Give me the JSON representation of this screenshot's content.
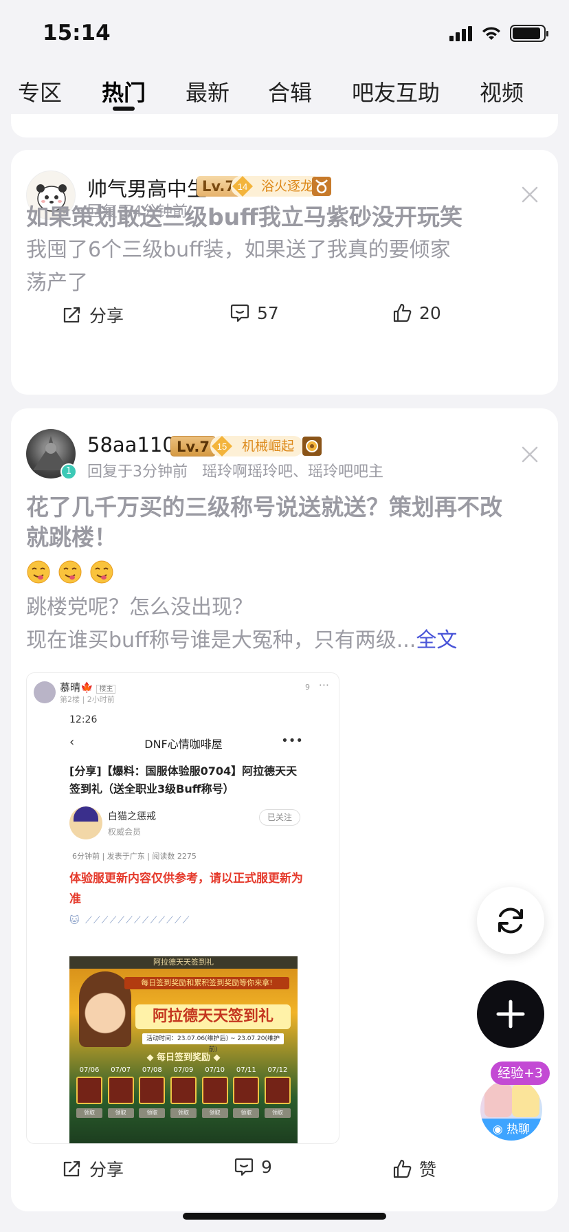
{
  "status_bar": {
    "time": "15:14"
  },
  "tabs": [
    {
      "label": "专区"
    },
    {
      "label": "热门"
    },
    {
      "label": "最新"
    },
    {
      "label": "合辑"
    },
    {
      "label": "吧友互助"
    },
    {
      "label": "视频"
    }
  ],
  "active_tab": "热门",
  "posts": [
    {
      "author": "帅气男高中生",
      "level": "Lv.7",
      "honor_level": "14",
      "honor_title": "浴火逐龙",
      "zodiac_icon": "taurus-icon",
      "meta": "回复于4分钟前",
      "title": "如果策划敢送三级buff我立马紫砂没开玩笑",
      "body": [
        "我囤了6个三级buff装，如果送了我真的要倾家",
        "荡产了"
      ],
      "share_label": "分享",
      "comment_count": "57",
      "like_count": "20"
    },
    {
      "author": "58aa110",
      "level": "Lv.7",
      "honor_level": "15",
      "honor_title": "机械崛起",
      "meta": "回复于3分钟前   瑶玲啊瑶玲吧、瑶玲吧吧主",
      "title": [
        "花了几千万买的三级称号说送就送？策划再不改",
        "就跳楼！"
      ],
      "body": [
        "跳楼党呢？怎么没出现？",
        "现在谁买buff称号谁是大冤种，只有两级..."
      ],
      "more_label": "全文",
      "share_label": "分享",
      "comment_count": "9",
      "like_label": "赞",
      "screenshot": {
        "poster": "慕晴🍁",
        "poster_badge": "楼主",
        "floor": "第2楼  |  2小时前",
        "view_count": "9",
        "time": "12:26",
        "page_title": "DNF心情咖啡屋",
        "headline": "[分享]【爆料：国服体验服0704】阿拉德天天签到礼（送全职业3级Buff称号）",
        "author": "白猫之惩戒",
        "member": "权威会员",
        "follow": "已关注",
        "info": "6分钟前 | 发表于广东 | 阅读数 2275",
        "notice": "体验服更新内容仅供参考，请以正式服更新为准",
        "banner_top": "阿拉德天天签到礼",
        "banner_sub": "每日签到奖励和累积签到奖励等你来拿!",
        "banner_title": "阿拉德天天签到礼",
        "banner_period": "活动时间：23.07.06(维护后) ~ 23.07.20(维护前)",
        "banner_reward": "◆ 每日签到奖励 ◆",
        "dates": [
          "07/06",
          "07/07",
          "07/08",
          "07/09",
          "07/10",
          "07/11",
          "07/12"
        ],
        "claim": "领取"
      }
    }
  ],
  "floating": {
    "exp_tag": "经验+3",
    "chat_label": "热聊"
  },
  "colors": {
    "accent": "#4a55d8",
    "notice_red": "#e53a2c",
    "honor_orange": "#dd8a1c"
  }
}
